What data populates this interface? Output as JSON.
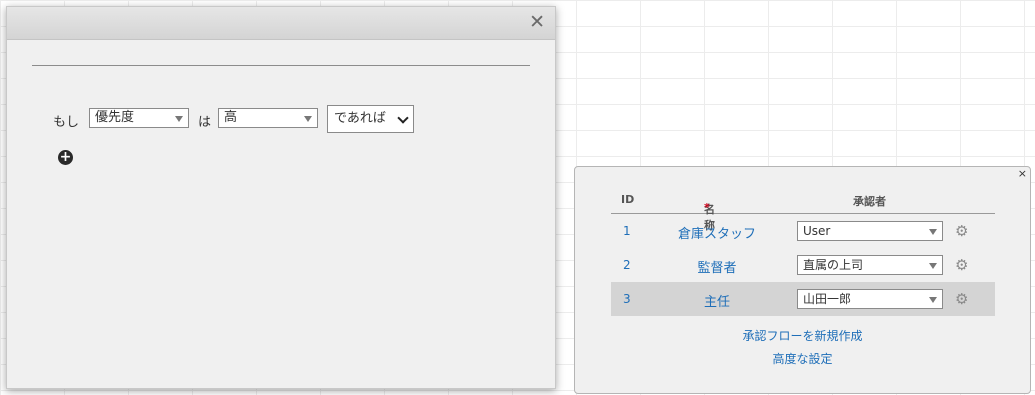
{
  "dialog": {
    "close_glyph": "✕",
    "condition": {
      "if_label": "もし",
      "field": "優先度",
      "is_label": "は",
      "value": "高",
      "suffix": "であれば"
    },
    "add_glyph": "+"
  },
  "approval_panel": {
    "close_glyph": "×",
    "headers": {
      "id": "ID",
      "name": "名称",
      "required_mark": "*",
      "approver": "承認者"
    },
    "rows": [
      {
        "id": "1",
        "name": "倉庫スタッフ",
        "approver": "User"
      },
      {
        "id": "2",
        "name": "監督者",
        "approver": "直属の上司"
      },
      {
        "id": "3",
        "name": "主任",
        "approver": "山田一郎",
        "selected": true
      }
    ],
    "gear_glyph": "⚙",
    "new_flow_link": "承認フローを新規作成",
    "advanced_link": "高度な設定"
  },
  "colors": {
    "link": "#1e6eb8",
    "required": "#d0021b",
    "selected_row": "#d4d4d4"
  }
}
